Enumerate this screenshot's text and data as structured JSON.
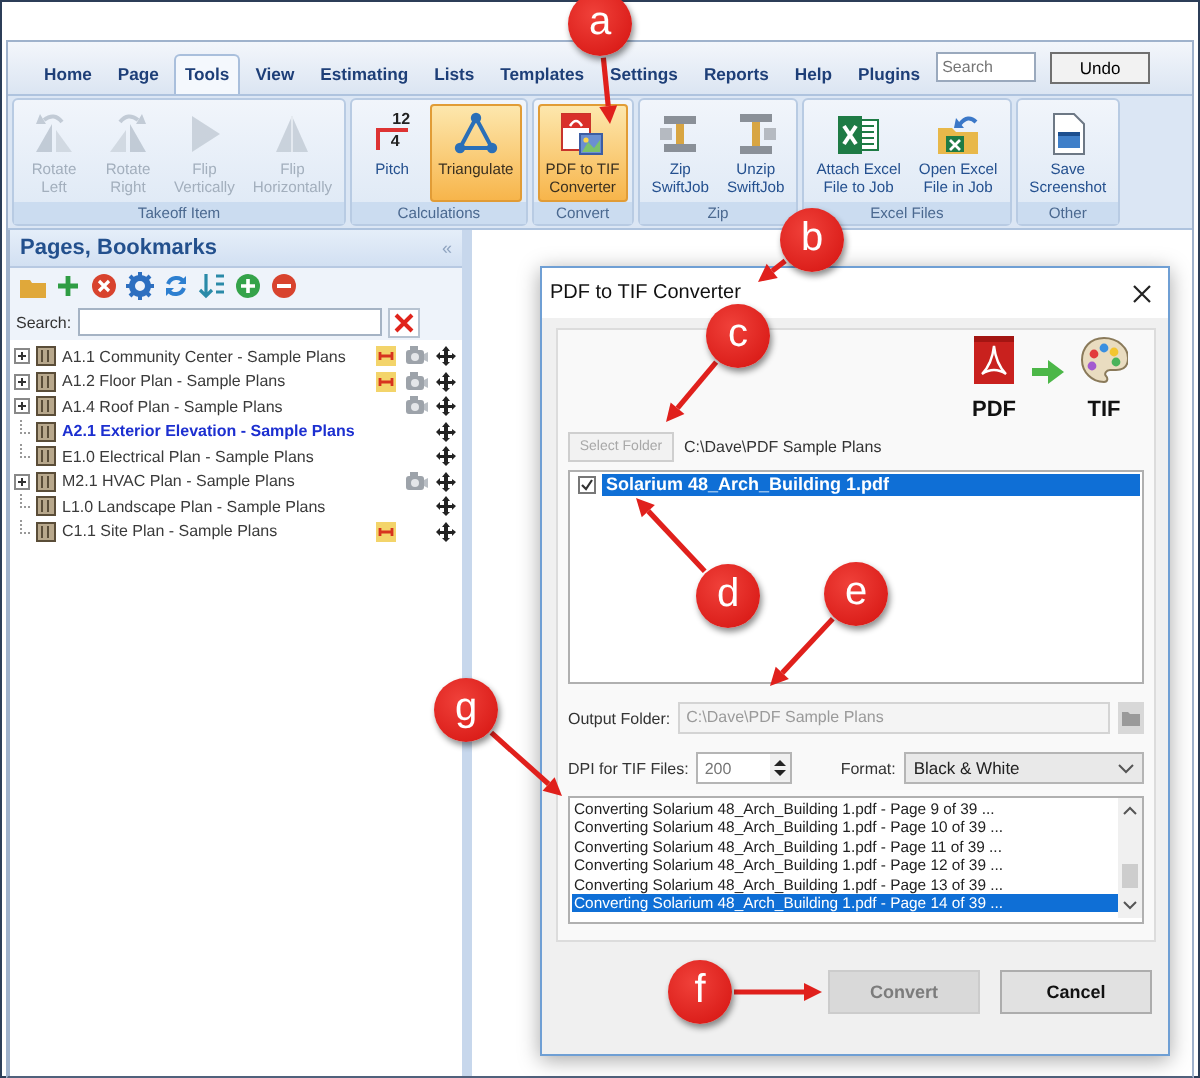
{
  "app_tabs": [
    {
      "label": "Home",
      "selected": false
    },
    {
      "label": "Page",
      "selected": false
    },
    {
      "label": "Tools",
      "selected": true
    },
    {
      "label": "View",
      "selected": false
    },
    {
      "label": "Estimating",
      "selected": false
    },
    {
      "label": "Lists",
      "selected": false
    },
    {
      "label": "Templates",
      "selected": false
    },
    {
      "label": "Settings",
      "selected": false
    },
    {
      "label": "Reports",
      "selected": false
    },
    {
      "label": "Help",
      "selected": false
    },
    {
      "label": "Plugins",
      "selected": false
    }
  ],
  "search": {
    "placeholder": "Search"
  },
  "undo_button": "Undo",
  "ribbon_groups": [
    {
      "label": "Takeoff Item",
      "buttons": [
        {
          "lines": [
            "Rotate",
            "Left"
          ],
          "kind": "rotate-left",
          "disabled": true,
          "active": false
        },
        {
          "lines": [
            "Rotate",
            "Right"
          ],
          "kind": "rotate-right",
          "disabled": true,
          "active": false
        },
        {
          "lines": [
            "Flip",
            "Vertically"
          ],
          "kind": "flip-vertical",
          "disabled": true,
          "active": false
        },
        {
          "lines": [
            "Flip",
            "Horizontally"
          ],
          "kind": "flip-horizontal",
          "disabled": true,
          "active": false
        }
      ]
    },
    {
      "label": "Calculations",
      "buttons": [
        {
          "lines": [
            "Pitch"
          ],
          "kind": "pitch",
          "icon_text": [
            "12",
            "4"
          ],
          "disabled": false,
          "active": false
        },
        {
          "lines": [
            "Triangulate"
          ],
          "kind": "triangulate",
          "disabled": false,
          "active": true
        }
      ]
    },
    {
      "label": "Convert",
      "buttons": [
        {
          "lines": [
            "PDF to TIF",
            "Converter"
          ],
          "kind": "pdf-convert",
          "disabled": false,
          "active": true
        }
      ]
    },
    {
      "label": "Zip",
      "buttons": [
        {
          "lines": [
            "Zip",
            "SwiftJob"
          ],
          "kind": "zip",
          "disabled": false,
          "active": false
        },
        {
          "lines": [
            "Unzip",
            "SwiftJob"
          ],
          "kind": "unzip",
          "disabled": false,
          "active": false
        }
      ]
    },
    {
      "label": "Excel Files",
      "buttons": [
        {
          "lines": [
            "Attach Excel",
            "File to Job"
          ],
          "kind": "excel-attach",
          "disabled": false,
          "active": false
        },
        {
          "lines": [
            "Open Excel",
            "File in Job"
          ],
          "kind": "excel-open",
          "disabled": false,
          "active": false
        }
      ]
    },
    {
      "label": "Other",
      "buttons": [
        {
          "lines": [
            "Save",
            "Screenshot"
          ],
          "kind": "screenshot",
          "disabled": false,
          "active": false
        }
      ]
    }
  ],
  "pages_panel": {
    "title": "Pages, Bookmarks",
    "collapse_glyph": "«",
    "search_label": "Search:",
    "pages": [
      {
        "label": "A1.1 Community Center - Sample Plans",
        "expandable": true,
        "selected": false,
        "takeoff": true,
        "photo": true
      },
      {
        "label": "A1.2 Floor Plan - Sample Plans",
        "expandable": true,
        "selected": false,
        "takeoff": true,
        "photo": true
      },
      {
        "label": "A1.4 Roof Plan - Sample Plans",
        "expandable": true,
        "selected": false,
        "takeoff": false,
        "photo": true
      },
      {
        "label": "A2.1 Exterior Elevation - Sample Plans",
        "expandable": false,
        "selected": true,
        "takeoff": false,
        "photo": false
      },
      {
        "label": "E1.0 Electrical Plan - Sample Plans",
        "expandable": false,
        "selected": false,
        "takeoff": false,
        "photo": false
      },
      {
        "label": "M2.1 HVAC Plan - Sample Plans",
        "expandable": true,
        "selected": false,
        "takeoff": false,
        "photo": true
      },
      {
        "label": "L1.0 Landscape Plan - Sample Plans",
        "expandable": false,
        "selected": false,
        "takeoff": false,
        "photo": false
      },
      {
        "label": "C1.1 Site Plan - Sample Plans",
        "expandable": false,
        "selected": false,
        "takeoff": true,
        "photo": false
      }
    ]
  },
  "dialog": {
    "title": "PDF to TIF Converter",
    "from_label": "PDF",
    "to_label": "TIF",
    "select_folder_button": {
      "label": "Select Folder",
      "disabled": true
    },
    "source_folder": "C:\\Dave\\PDF Sample Plans",
    "files": [
      {
        "name": "Solarium 48_Arch_Building 1.pdf",
        "checked": true,
        "selected": true
      }
    ],
    "output_folder": {
      "label": "Output Folder:",
      "value": "C:\\Dave\\PDF Sample Plans",
      "disabled": true
    },
    "dpi": {
      "label": "DPI for TIF Files:",
      "value": "200"
    },
    "format": {
      "label": "Format:",
      "value": "Black & White"
    },
    "log": [
      {
        "text": "Converting Solarium 48_Arch_Building 1.pdf - Page 9 of 39 ...",
        "selected": false
      },
      {
        "text": "Converting Solarium 48_Arch_Building 1.pdf - Page 10 of 39 ...",
        "selected": false
      },
      {
        "text": "Converting Solarium 48_Arch_Building 1.pdf - Page 11 of 39 ...",
        "selected": false
      },
      {
        "text": "Converting Solarium 48_Arch_Building 1.pdf - Page 12 of 39 ...",
        "selected": false
      },
      {
        "text": "Converting Solarium 48_Arch_Building 1.pdf - Page 13 of 39 ...",
        "selected": false
      },
      {
        "text": "Converting Solarium 48_Arch_Building 1.pdf - Page 14 of 39 ...",
        "selected": true
      }
    ],
    "buttons": [
      {
        "label": "Convert",
        "disabled": true
      },
      {
        "label": "Cancel",
        "disabled": false
      }
    ]
  },
  "callouts": [
    {
      "letter": "a"
    },
    {
      "letter": "b"
    },
    {
      "letter": "c"
    },
    {
      "letter": "d"
    },
    {
      "letter": "e"
    },
    {
      "letter": "f"
    },
    {
      "letter": "g"
    }
  ]
}
